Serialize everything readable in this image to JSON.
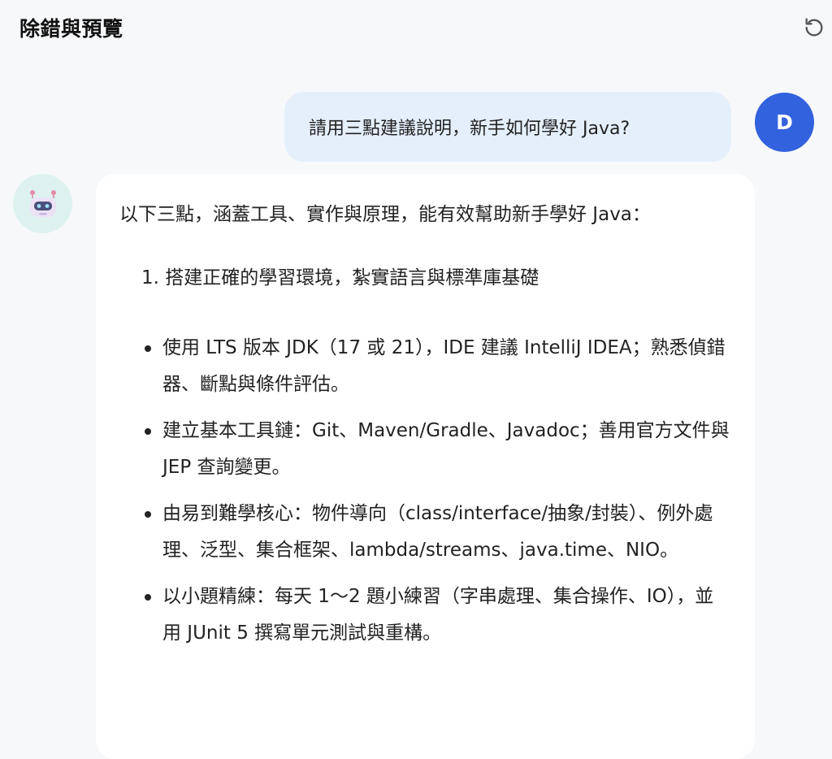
{
  "header": {
    "title": "除錯與預覽",
    "refresh_icon": "refresh-icon"
  },
  "user_message": {
    "avatar_letter": "D",
    "avatar_color": "#3262dd",
    "bubble_color": "#e5effc",
    "text": "請用三點建議說明，新手如何學好 Java?"
  },
  "bot_message": {
    "avatar_icon": "robot-icon",
    "avatar_bg": "#ddf2ef",
    "intro": "以下三點，涵蓋工具、實作與原理，能有效幫助新手學好 Java：",
    "section_1_heading": "1. 搭建正確的學習環境，紮實語言與標準庫基礎",
    "bullets": [
      "使用 LTS 版本 JDK（17 或 21），IDE 建議 IntelliJ IDEA；熟悉偵錯器、斷點與條件評估。",
      "建立基本工具鏈：Git、Maven/Gradle、Javadoc；善用官方文件與 JEP 查詢變更。",
      "由易到難學核心：物件導向（class/interface/抽象/封裝）、例外處理、泛型、集合框架、lambda/streams、java.time、NIO。",
      "以小題精練：每天 1～2 題小練習（字串處理、集合操作、IO），並用 JUnit 5 撰寫單元測試與重構。"
    ]
  }
}
